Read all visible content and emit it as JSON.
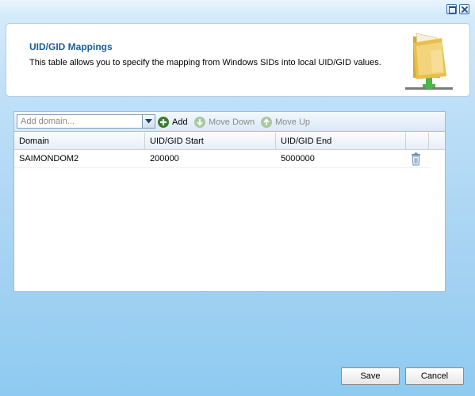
{
  "header": {
    "title": "UID/GID Mappings",
    "description": "This table allows you to specify the mapping from Windows SIDs into local UID/GID values.",
    "icon": "folder-icon"
  },
  "toolbar": {
    "domain_placeholder": "Add domain...",
    "add_label": "Add",
    "move_down_label": "Move Down",
    "move_up_label": "Move Up"
  },
  "grid": {
    "columns": [
      "Domain",
      "UID/GID Start",
      "UID/GID End"
    ],
    "rows": [
      {
        "domain": "SAIMONDOM2",
        "start": "200000",
        "end": "5000000"
      }
    ]
  },
  "footer": {
    "save_label": "Save",
    "cancel_label": "Cancel"
  },
  "colors": {
    "title": "#1c5c9a",
    "add_icon": "#3a7d2c",
    "disabled_icon": "#a8c8a0"
  }
}
